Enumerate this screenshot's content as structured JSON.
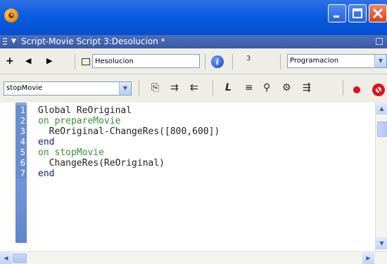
{
  "window": {
    "title_bar_color": "#0a5ce0",
    "app_icon": "director-icon",
    "minimize_icon": "minimize-icon",
    "maximize_icon": "maximize-icon",
    "close_icon": "close-icon"
  },
  "script_window": {
    "title": "Script-Movie Script 3:Desolucion *"
  },
  "toolbar1": {
    "name_value": "Hesolucion",
    "cast_number": "3",
    "type_select": "Programacion"
  },
  "toolbar2": {
    "handler_select": "stopMovie",
    "record_color": "#e0101e"
  },
  "editor": {
    "lines": [
      {
        "num": "1",
        "text": "Global ReOriginal",
        "color": "black"
      },
      {
        "num": "2",
        "text": "on prepareMovie",
        "color": "green"
      },
      {
        "num": "3",
        "text": "  ReOriginal-ChangeRes([800,600])",
        "color": "black"
      },
      {
        "num": "4",
        "text": "end",
        "color": "navy"
      },
      {
        "num": "5",
        "text": "on stopMovie",
        "color": "green"
      },
      {
        "num": "6",
        "text": "  ChangeRes(ReOriginal)",
        "color": "black"
      },
      {
        "num": "7",
        "text": "end",
        "color": "navy"
      }
    ]
  }
}
